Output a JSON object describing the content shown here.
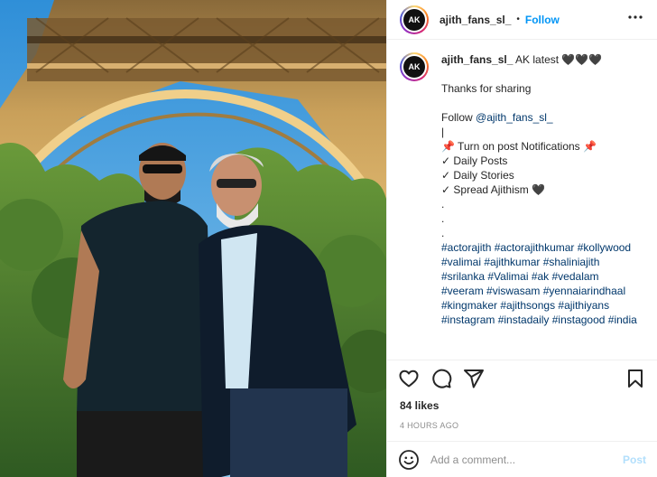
{
  "header": {
    "username": "ajith_fans_sl_",
    "separator": "•",
    "follow_label": "Follow",
    "avatar_text": "AK"
  },
  "caption": {
    "username": "ajith_fans_sl_",
    "title": "AK latest 🖤🖤🖤",
    "lines": [
      "Thanks for sharing",
      "",
      "Follow @ajith_fans_sl_",
      "|",
      "📌 Turn on post Notifications 📌",
      "✓ Daily Posts",
      "✓ Daily Stories",
      "✓ Spread Ajithism 🖤",
      ".",
      ".",
      "."
    ],
    "follow_prefix": "Follow ",
    "follow_handle": "@ajith_fans_sl_",
    "hashtags": "#actorajith #actorajithkumar #kollywood #valimai #ajithkumar #shaliniajith #srilanka #Valimai #ak #vedalam #veeram #viswasam #yennaiarindhaal #kingmaker #ajithsongs #ajithiyans #instagram #instadaily #instagood #india"
  },
  "actions": {
    "like_icon": "heart-icon",
    "comment_icon": "comment-icon",
    "share_icon": "share-icon",
    "save_icon": "bookmark-icon"
  },
  "likes": "84 likes",
  "time": "4 HOURS AGO",
  "comment_box": {
    "placeholder": "Add a comment...",
    "post_label": "Post"
  }
}
